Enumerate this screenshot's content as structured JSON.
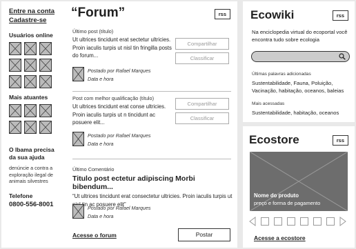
{
  "sidebar": {
    "login_link": "Entre na conta",
    "signup_link": "Cadastre-se",
    "online_heading": "Usuários online",
    "active_heading": "Mais atuantes",
    "ibama_heading": "O Ibama precisa da sua ajuda",
    "ibama_text": "denúncie a contra a exploração ilegal de animais silvestres",
    "phone_label": "Telefone",
    "phone_number": "0800-556-8001"
  },
  "forum": {
    "title": "“Forum”",
    "rss": "rss",
    "latest": {
      "label": "Último post (título)",
      "text": "Ut ultrices tincidunt erat sectetur ultricies. Proin iaculis turpis ut nisl tin fringilla posts do forum...",
      "share": "Compartilhar",
      "rate": "Classificar",
      "author": "Postado por Rafael Marques",
      "date": "Data e hora"
    },
    "best": {
      "label": "Post com melhor qualificação (título)",
      "text": "Ut ultrices tincidunt erat conse ultricies. Proin iaculis turpis ut n tincidunt ac posuere elit...",
      "share": "Compartilhar",
      "rate": "Classificar",
      "author": "Postado por Rafael Marques",
      "date": "Data e hora"
    },
    "comment": {
      "label": "Último Comentário",
      "title": "Titulo post ectetur adipiscing Morbi bibendum...",
      "text": "“Ut ultrices tincidunt erat consectetur ultricies. Proin iaculis turpis ut nisl tin ac posuere elit”",
      "author": "Postado por Rafael Marques",
      "date": "Data e hora"
    },
    "access_link": "Acesse o forum",
    "post_button": "Postar"
  },
  "ecowiki": {
    "title": "Ecowiki",
    "rss": "rss",
    "description": "Na enciclopedia virtual do ecoportal você encontra tudo sobre ecologia",
    "search_placeholder": "",
    "recent_label": "Últimas palavras adicionadas",
    "recent_values": "Sustentabilidade, Fauna, Poluição, Vacinação, habitação, oceanos, baleias",
    "popular_label": "Mais acessadas",
    "popular_values": "Sustentabilidade, habitação, oceanos"
  },
  "ecostore": {
    "title": "Ecostore",
    "rss": "rss",
    "product_name": "Nome do produto",
    "product_price": "preço e forma de pagamento",
    "access_link": "Acesse a ecostore"
  },
  "icons": {
    "placeholder_image": "x-box-image-icon",
    "search": "magnifier-icon",
    "carousel_prev": "triangle-left-icon",
    "carousel_next": "triangle-right-icon"
  }
}
